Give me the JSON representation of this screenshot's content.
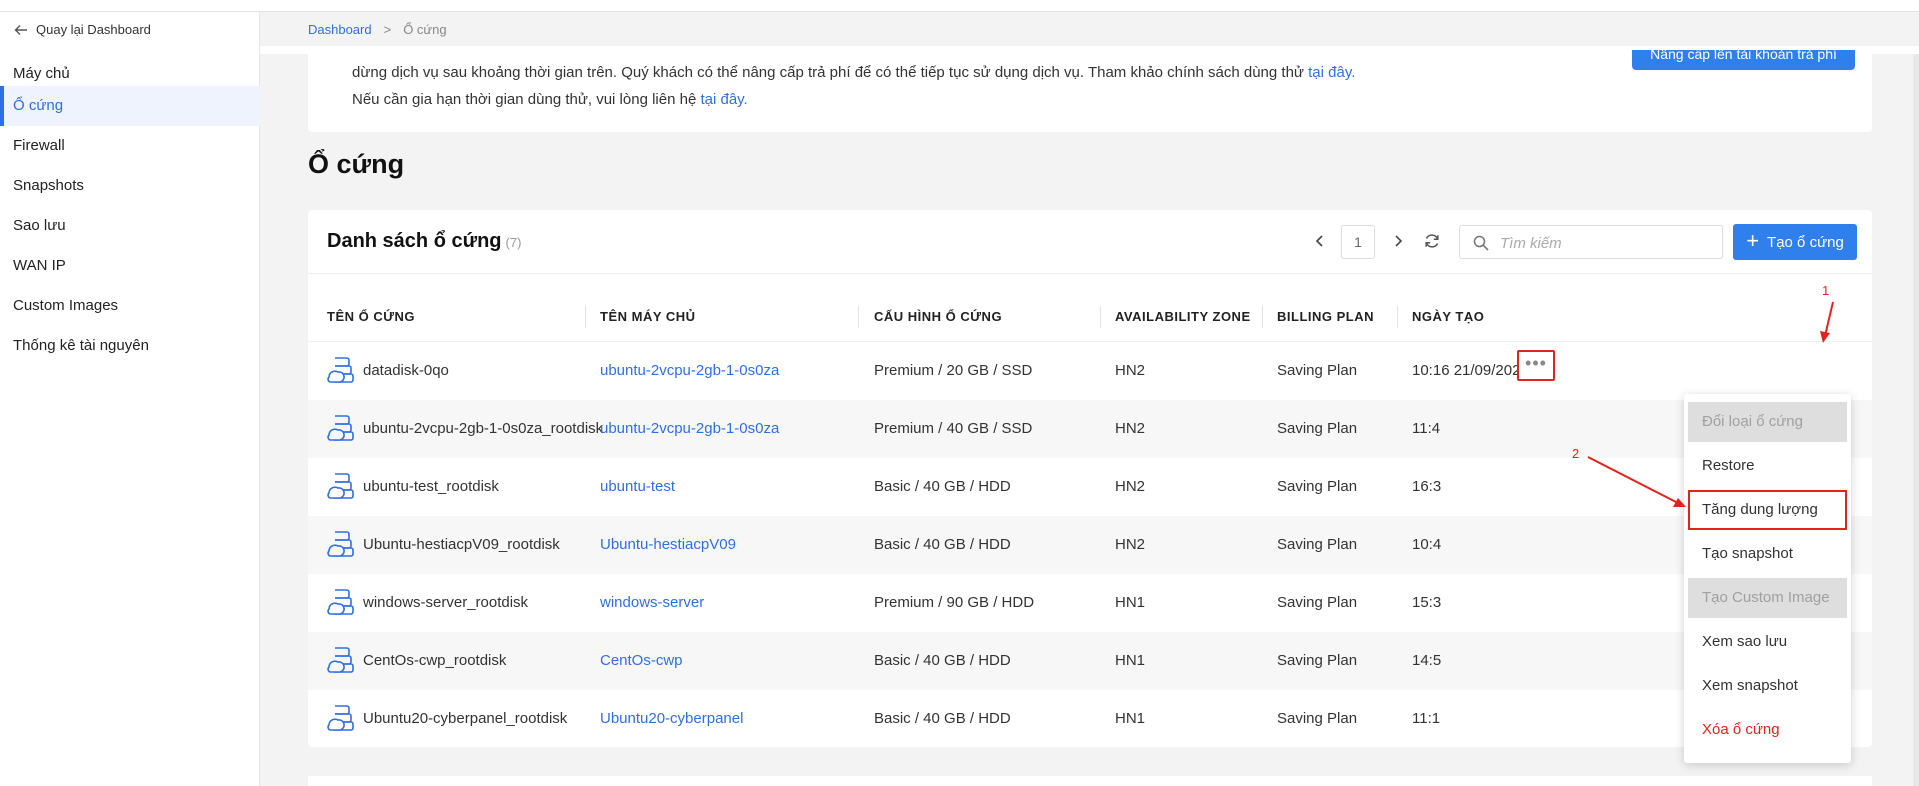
{
  "sidebar": {
    "back_label": "Quay lại Dashboard",
    "items": [
      {
        "label": "Máy chủ"
      },
      {
        "label": "Ổ cứng",
        "active": true
      },
      {
        "label": "Firewall"
      },
      {
        "label": "Snapshots"
      },
      {
        "label": "Sao lưu"
      },
      {
        "label": "WAN IP"
      },
      {
        "label": "Custom Images"
      },
      {
        "label": "Thống kê tài nguyên"
      }
    ]
  },
  "breadcrumb": {
    "root": "Dashboard",
    "separator": ">",
    "current": "Ổ cứng"
  },
  "notice": {
    "line1": "dừng dịch vụ sau khoảng thời gian trên. Quý khách có thể nâng cấp trả phí để có thể tiếp tục sử dụng dịch vụ. Tham khảo chính sách dùng thử",
    "line1_link": "tại đây.",
    "line2": "Nếu cần gia hạn thời gian dùng thử, vui lòng liên hệ",
    "line2_link": "tại đây.",
    "upgrade_button": "Nâng cấp lên tài khoản trả phí"
  },
  "page_title": "Ổ cứng",
  "list": {
    "title": "Danh sách ổ cứng",
    "count": "(7)",
    "page": "1",
    "search_placeholder": "Tìm kiếm",
    "create_button": "Tạo ổ cứng",
    "columns": [
      "TÊN Ổ CỨNG",
      "TÊN MÁY CHỦ",
      "CẤU HÌNH Ổ CỨNG",
      "AVAILABILITY ZONE",
      "BILLING PLAN",
      "NGÀY TẠO"
    ],
    "rows": [
      {
        "name": "datadisk-0qo",
        "server": "ubuntu-2vcpu-2gb-1-0s0za",
        "config": "Premium / 20 GB / SSD",
        "zone": "HN2",
        "plan": "Saving Plan",
        "created": "10:16 21/09/2022"
      },
      {
        "name": "ubuntu-2vcpu-2gb-1-0s0za_rootdisk",
        "server": "ubuntu-2vcpu-2gb-1-0s0za",
        "config": "Premium / 40 GB / SSD",
        "zone": "HN2",
        "plan": "Saving Plan",
        "created": "11:4"
      },
      {
        "name": "ubuntu-test_rootdisk",
        "server": "ubuntu-test",
        "config": "Basic / 40 GB / HDD",
        "zone": "HN2",
        "plan": "Saving Plan",
        "created": "16:3"
      },
      {
        "name": "Ubuntu-hestiacpV09_rootdisk",
        "server": "Ubuntu-hestiacpV09",
        "config": "Basic / 40 GB / HDD",
        "zone": "HN2",
        "plan": "Saving Plan",
        "created": "10:4"
      },
      {
        "name": "windows-server_rootdisk",
        "server": "windows-server",
        "config": "Premium / 90 GB / HDD",
        "zone": "HN1",
        "plan": "Saving Plan",
        "created": "15:3"
      },
      {
        "name": "CentOs-cwp_rootdisk",
        "server": "CentOs-cwp",
        "config": "Basic / 40 GB / HDD",
        "zone": "HN1",
        "plan": "Saving Plan",
        "created": "14:5"
      },
      {
        "name": "Ubuntu20-cyberpanel_rootdisk",
        "server": "Ubuntu20-cyberpanel",
        "config": "Basic / 40 GB / HDD",
        "zone": "HN1",
        "plan": "Saving Plan",
        "created": "11:1"
      }
    ],
    "more_button": "•••"
  },
  "menu": {
    "items": [
      {
        "label": "Đổi loại ổ cứng",
        "disabled": true
      },
      {
        "label": "Restore"
      },
      {
        "label": "Tăng dung lượng",
        "highlight": true
      },
      {
        "label": "Tạo snapshot"
      },
      {
        "label": "Tạo Custom Image",
        "disabled": true
      },
      {
        "label": "Xem sao lưu"
      },
      {
        "label": "Xem snapshot"
      },
      {
        "label": "Xóa ổ cứng",
        "danger": true
      }
    ]
  },
  "annotations": {
    "step1": "1",
    "step2": "2"
  },
  "colors": {
    "accent": "#2f80ed",
    "link": "#2f6fe4",
    "annotation": "#e0241b",
    "danger": "#e0241b"
  }
}
